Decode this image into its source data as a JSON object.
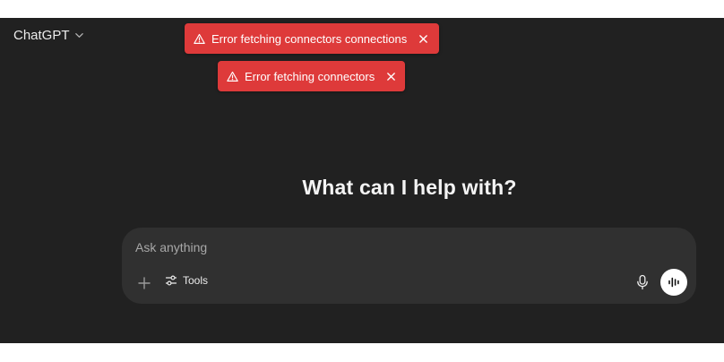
{
  "header": {
    "model_name": "ChatGPT",
    "model_icon": "chevron-down-icon"
  },
  "toasts": [
    {
      "message": "Error fetching connectors connections",
      "icon": "warning-icon",
      "color": "#de3a3a"
    },
    {
      "message": "Error fetching connectors",
      "icon": "warning-icon",
      "color": "#de3a3a"
    }
  ],
  "main": {
    "title": "What can I help with?"
  },
  "composer": {
    "placeholder": "Ask anything",
    "value": "",
    "tools_label": "Tools",
    "icons": [
      "plus-icon",
      "sliders-icon",
      "microphone-icon",
      "voice-waveform-icon"
    ]
  },
  "theme": {
    "background": "#212121",
    "composer_background": "#303030",
    "text": "#ececec"
  }
}
